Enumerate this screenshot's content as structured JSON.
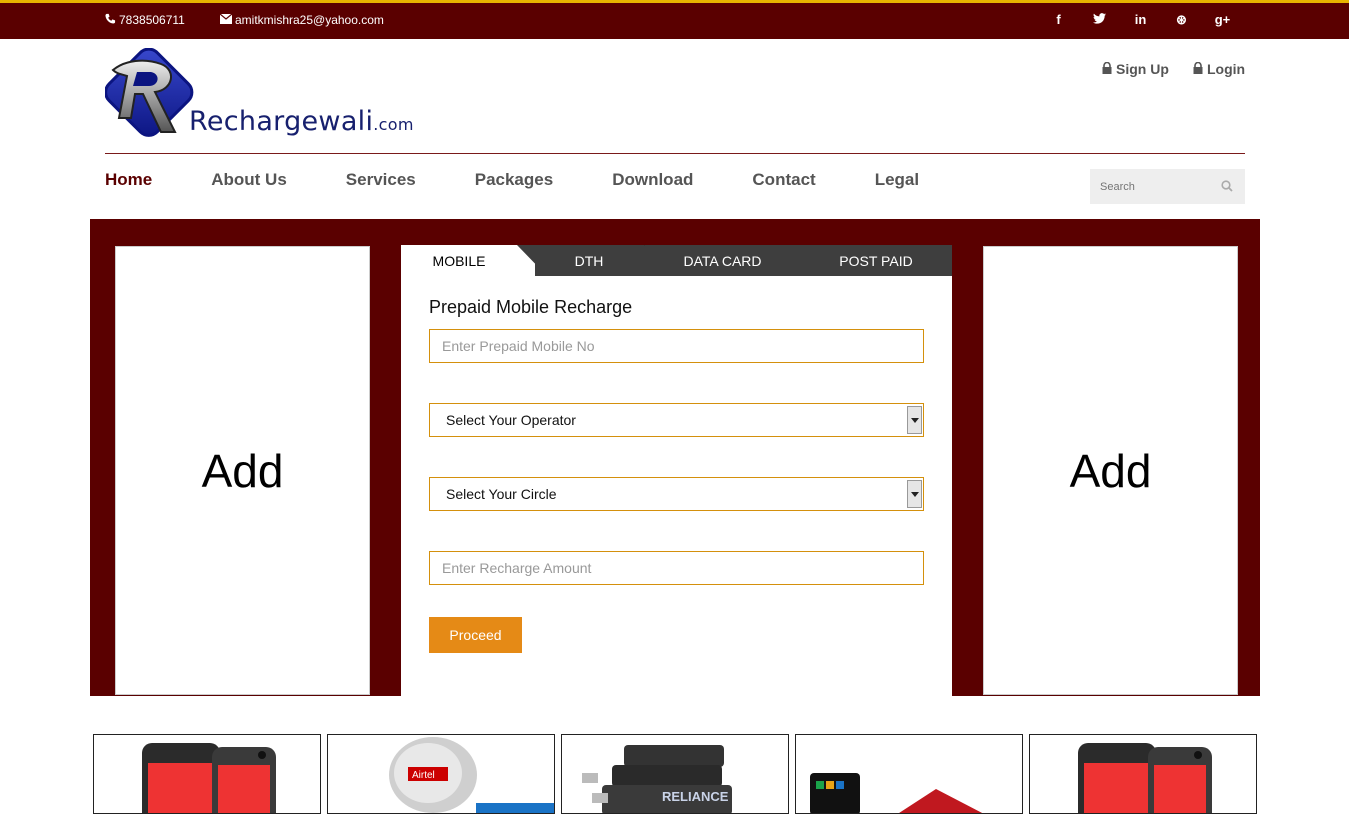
{
  "topbar": {
    "phone": "7838506711",
    "email": "amitkmishra25@yahoo.com",
    "socials": [
      {
        "icon": "facebook-icon",
        "glyph": "f"
      },
      {
        "icon": "twitter-icon",
        "glyph": "t"
      },
      {
        "icon": "linkedin-icon",
        "glyph": "in"
      },
      {
        "icon": "dribbble-icon",
        "glyph": "⊛"
      },
      {
        "icon": "google-plus-icon",
        "glyph": "g+"
      }
    ]
  },
  "logo": {
    "name": "Rechargewali",
    "suffix": ".com"
  },
  "auth": {
    "signup": "Sign Up",
    "login": "Login"
  },
  "nav": {
    "items": [
      "Home",
      "About Us",
      "Services",
      "Packages",
      "Download",
      "Contact",
      "Legal"
    ],
    "active": "Home"
  },
  "search": {
    "placeholder": "Search"
  },
  "ads": {
    "left": "Add",
    "right": "Add"
  },
  "recharge": {
    "tabs": [
      "MOBILE",
      "DTH",
      "DATA CARD",
      "POST PAID"
    ],
    "title": "Prepaid Mobile Recharge",
    "mobile_placeholder": "Enter Prepaid Mobile No",
    "operator_value": "Select Your Operator",
    "circle_value": "Select Your Circle",
    "amount_placeholder": "Enter Recharge Amount",
    "proceed": "Proceed"
  },
  "colors": {
    "brand": "#5a0000",
    "accent": "#e58a16",
    "border": "#d4900c",
    "gold": "#e8b400"
  },
  "thumbnails": [
    "phone-case",
    "airtel-dish",
    "reliance-data-card",
    "nokia-phone",
    "phone-case"
  ]
}
